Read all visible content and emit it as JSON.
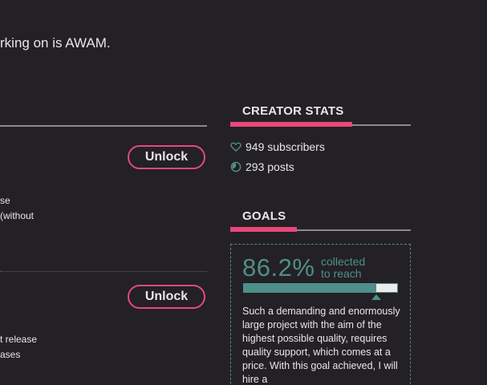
{
  "intro": {
    "text": "rking on is AWAM."
  },
  "tiers": [
    {
      "unlock_label": "Unlock",
      "fragments": [
        "se",
        " (without"
      ]
    },
    {
      "unlock_label": "Unlock",
      "fragments": [
        "t release",
        "ases"
      ]
    }
  ],
  "creator_stats": {
    "title": "CREATOR STATS",
    "subscribers": "949 subscribers",
    "posts": "293 posts",
    "subscribers_icon": "heart-icon",
    "posts_icon": "pie-icon"
  },
  "goals": {
    "title": "GOALS",
    "percent_label": "86.2%",
    "percent_value": 86.2,
    "caption_line1": "collected",
    "caption_line2": "to reach",
    "description": "Such a demanding and enormously large project with the aim of the highest possible quality, requires quality support, which comes at a price. With this goal achieved, I will hire a"
  },
  "colors": {
    "accent_pink": "#e8487a",
    "accent_teal": "#4f8f89",
    "background": "#232125",
    "text": "#e8e6e9"
  }
}
